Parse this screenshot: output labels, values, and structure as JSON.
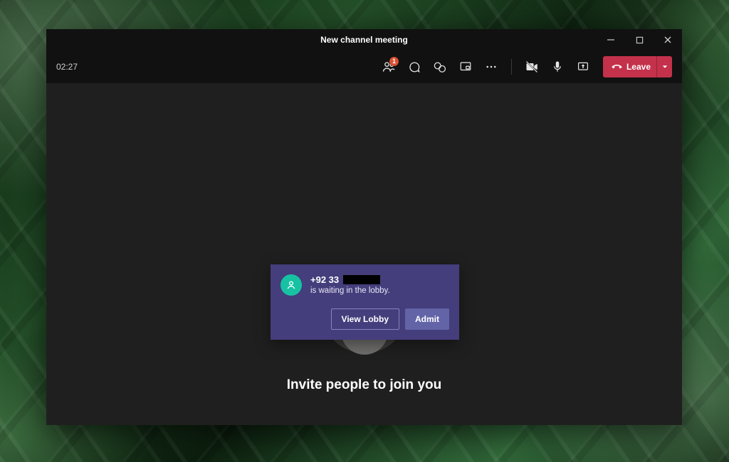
{
  "window": {
    "title": "New channel meeting"
  },
  "toolbar": {
    "timer": "02:27",
    "people_badge": "1",
    "leave_label": "Leave"
  },
  "stage": {
    "invite_text": "Invite people to join you"
  },
  "lobby_toast": {
    "caller_prefix": "+92 33",
    "message": "is waiting in the lobby.",
    "view_label": "View Lobby",
    "admit_label": "Admit"
  }
}
